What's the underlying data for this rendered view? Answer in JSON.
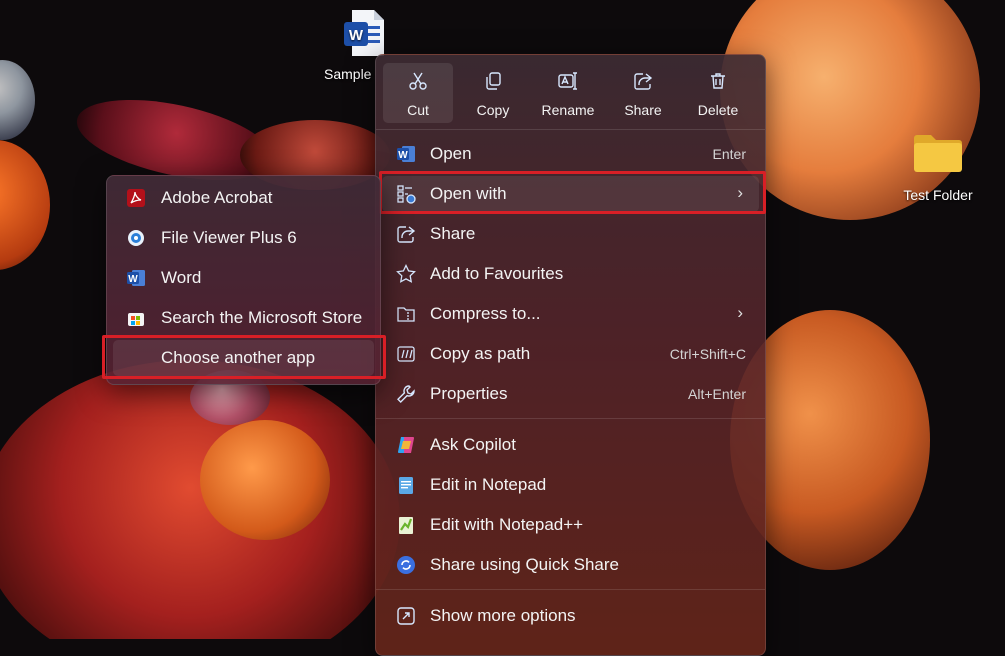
{
  "desktop": {
    "icons": [
      {
        "label": "Sample",
        "kind": "word-document"
      },
      {
        "label": "Test Folder",
        "kind": "folder"
      }
    ]
  },
  "toolbar": {
    "cut": "Cut",
    "copy": "Copy",
    "rename": "Rename",
    "share": "Share",
    "delete": "Delete"
  },
  "menu": {
    "items": [
      {
        "label": "Open",
        "shortcut": "Enter",
        "icon": "word-icon"
      },
      {
        "label": "Open with",
        "icon": "open-with-icon",
        "submenu": true,
        "highlighted": true
      },
      {
        "label": "Share",
        "icon": "share-icon"
      },
      {
        "label": "Add to Favourites",
        "icon": "star-icon"
      },
      {
        "label": "Compress to...",
        "icon": "zip-icon",
        "submenu": true
      },
      {
        "label": "Copy as path",
        "shortcut": "Ctrl+Shift+C",
        "icon": "copy-path-icon"
      },
      {
        "label": "Properties",
        "shortcut": "Alt+Enter",
        "icon": "wrench-icon"
      },
      {
        "label": "Ask Copilot",
        "icon": "copilot-icon"
      },
      {
        "label": "Edit in Notepad",
        "icon": "notepad-icon"
      },
      {
        "label": "Edit with Notepad++",
        "icon": "notepad-plus-plus-icon"
      },
      {
        "label": "Share using Quick Share",
        "icon": "quick-share-icon"
      },
      {
        "label": "Show more options",
        "icon": "more-options-icon"
      }
    ]
  },
  "submenu": {
    "items": [
      {
        "label": "Adobe Acrobat",
        "icon": "acrobat-icon"
      },
      {
        "label": "File Viewer Plus 6",
        "icon": "file-viewer-icon"
      },
      {
        "label": "Word",
        "icon": "word-icon"
      },
      {
        "label": "Search the Microsoft Store",
        "icon": "store-icon"
      },
      {
        "label": "Choose another app",
        "icon": "",
        "highlighted": true
      }
    ]
  },
  "colors": {
    "highlight_border": "#d81f26",
    "word_blue": "#2b5bb8",
    "folder_yellow": "#f5c842"
  }
}
